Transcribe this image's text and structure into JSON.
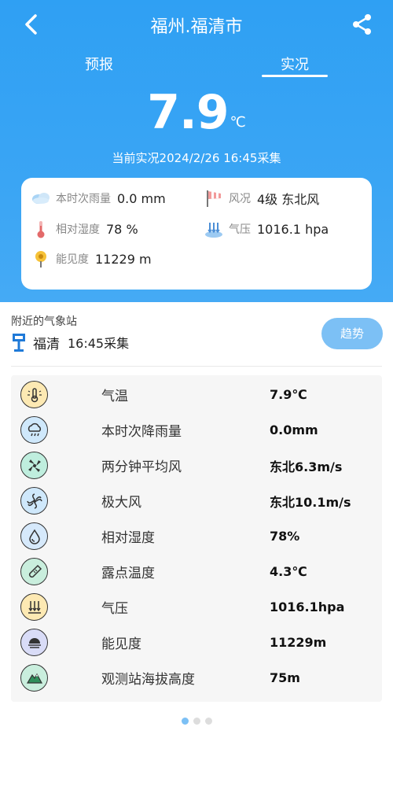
{
  "header": {
    "title": "福州.福清市"
  },
  "tabs": [
    {
      "label": "预报"
    },
    {
      "label": "实况"
    }
  ],
  "current": {
    "temp": "7.9",
    "unit": "℃",
    "obs_time": "当前实况2024/2/26 16:45采集"
  },
  "summary": [
    {
      "label": "本时次雨量",
      "value": "0.0 mm",
      "icon": "rain-cloud-icon"
    },
    {
      "label": "风况",
      "value": "4级 东北风",
      "icon": "windsock-icon"
    },
    {
      "label": "相对湿度",
      "value": "78 %",
      "icon": "thermometer-icon"
    },
    {
      "label": "气压",
      "value": "1016.1 hpa",
      "icon": "pressure-icon"
    },
    {
      "label": "能见度",
      "value": "11229 m",
      "icon": "visibility-icon"
    }
  ],
  "nearby": {
    "title": "附近的气象站",
    "station": "福清",
    "time": "16:45采集",
    "trend_label": "趋势"
  },
  "rows": [
    {
      "label": "气温",
      "value": "7.9℃",
      "icon": "thermometer-sun-icon",
      "color": "#fde9b3"
    },
    {
      "label": "本时次降雨量",
      "value": "0.0mm",
      "icon": "rain-cloud-icon",
      "color": "#cfe8fb"
    },
    {
      "label": "两分钟平均风",
      "value": "东北6.3m/s",
      "icon": "fan-icon",
      "color": "#bfeede"
    },
    {
      "label": "极大风",
      "value": "东北10.1m/s",
      "icon": "turbine-icon",
      "color": "#cfe8fb"
    },
    {
      "label": "相对湿度",
      "value": "78%",
      "icon": "water-drop-icon",
      "color": "#d6e9fb"
    },
    {
      "label": "露点温度",
      "value": "4.3℃",
      "icon": "dew-thermometer-icon",
      "color": "#c9eedd"
    },
    {
      "label": "气压",
      "value": "1016.1hpa",
      "icon": "pressure-arrows-icon",
      "color": "#fde9b3"
    },
    {
      "label": "能见度",
      "value": "11229m",
      "icon": "horizon-icon",
      "color": "#d9dcf7"
    },
    {
      "label": "观测站海拔高度",
      "value": "75m",
      "icon": "mountain-icon",
      "color": "#c9eedd"
    }
  ],
  "pager": {
    "active": 1,
    "total": 3
  },
  "colors": {
    "primary": "#36a3f4",
    "button": "#7cc0f5"
  }
}
